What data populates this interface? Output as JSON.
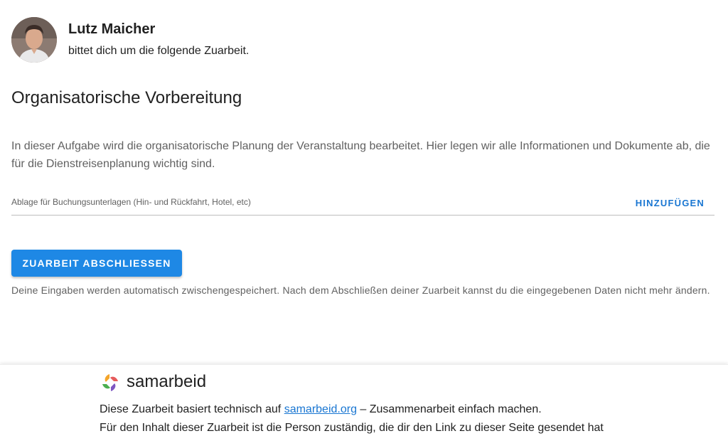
{
  "sender": {
    "name": "Lutz Maicher",
    "subtitle": "bittet dich um die folgende Zuarbeit."
  },
  "task": {
    "title": "Organisatorische Vorbereitung",
    "description": "In dieser Aufgabe wird die organisatorische Planung der Veranstaltung bearbeitet. Hier legen wir alle Informationen und Dokumente ab, die für die Dienstreisenplanung wichtig sind."
  },
  "upload": {
    "label": "Ablage für Buchungsunterlagen (Hin- und Rückfahrt, Hotel, etc)",
    "add_label": "HINZUFÜGEN"
  },
  "submit": {
    "label": "ZUARBEIT ABSCHLIESSEN",
    "note": "Deine Eingaben werden automatisch zwischengespeichert. Nach dem Abschließen deiner Zuarbeit kannst du die eingegebenen Daten nicht mehr ändern."
  },
  "footer": {
    "brand": "samarbeid",
    "line1_prefix": "Diese Zuarbeit basiert technisch auf ",
    "line1_link": "samarbeid.org",
    "line1_suffix": " – Zusammenarbeit einfach machen.",
    "line2": "Für den Inhalt dieser Zuarbeit ist die Person zuständig, die dir den Link zu dieser Seite gesendet hat"
  },
  "colors": {
    "primary": "#1e88e5",
    "link": "#1976d2"
  }
}
